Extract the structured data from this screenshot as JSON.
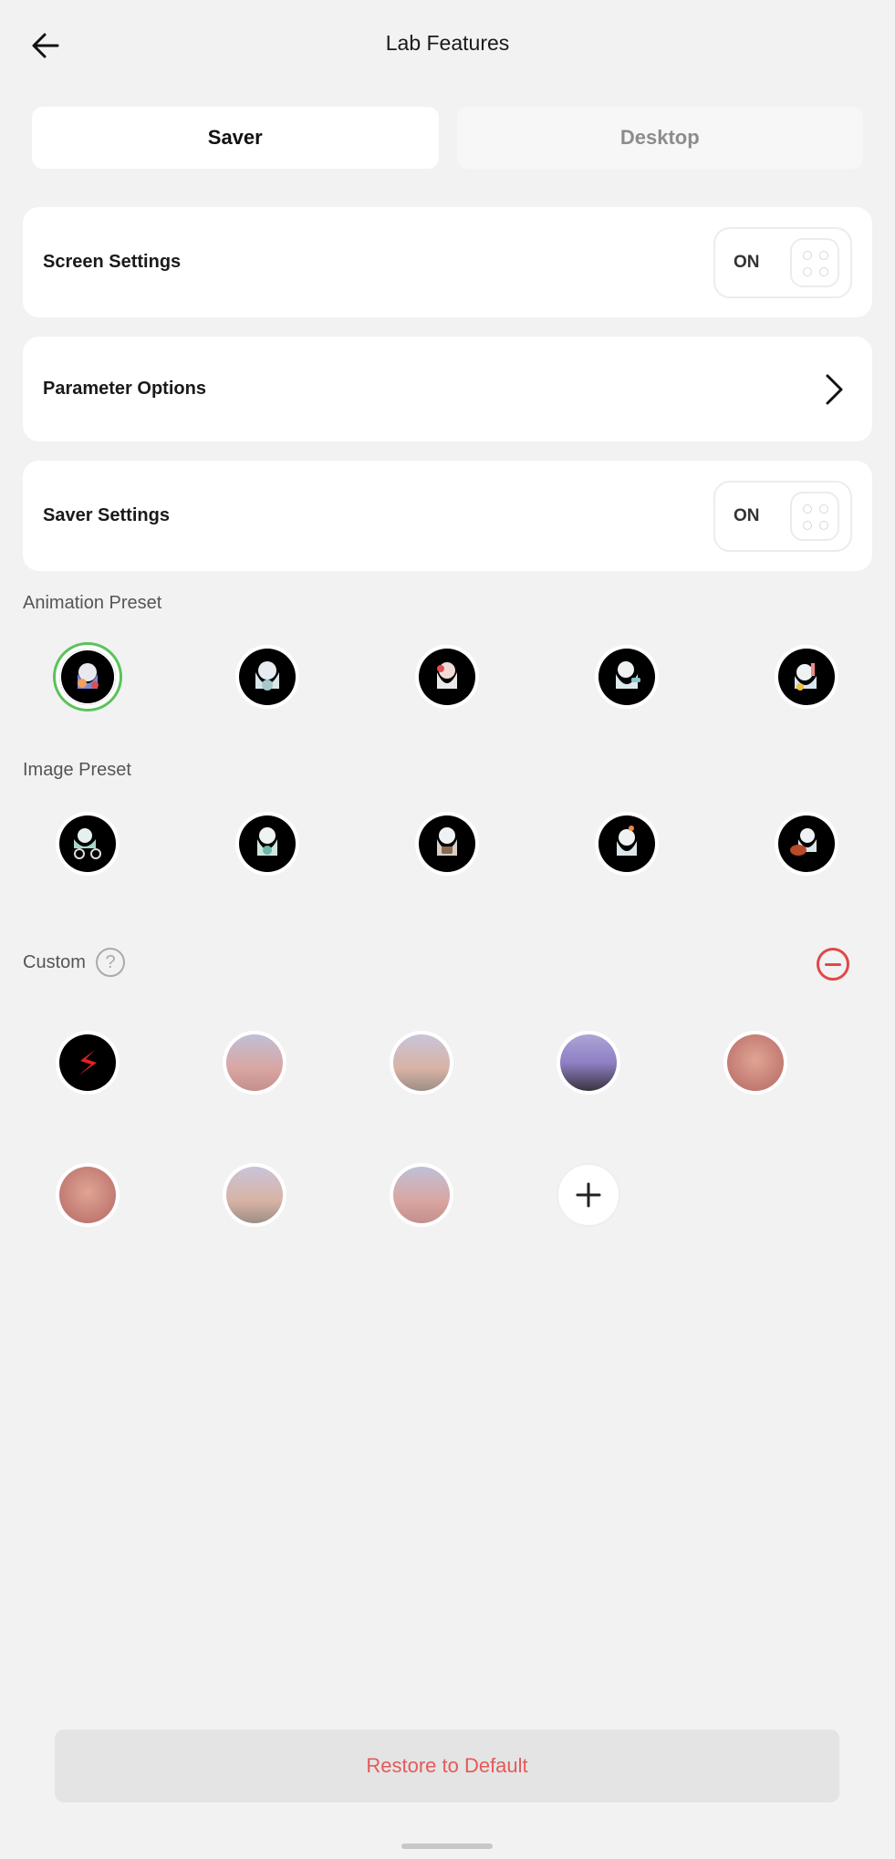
{
  "header": {
    "title": "Lab Features",
    "back_icon": "arrow-left-icon"
  },
  "tabs": [
    {
      "label": "Saver",
      "active": true
    },
    {
      "label": "Desktop",
      "active": false
    }
  ],
  "settings": {
    "screen": {
      "label": "Screen Settings",
      "state": "ON"
    },
    "parameter": {
      "label": "Parameter Options"
    },
    "saver": {
      "label": "Saver Settings",
      "state": "ON"
    }
  },
  "animation_preset": {
    "label": "Animation Preset",
    "count": 5,
    "selected_index": 0
  },
  "image_preset": {
    "label": "Image Preset",
    "count": 5
  },
  "custom": {
    "label": "Custom",
    "help_icon": "?",
    "count": 8
  },
  "restore_label": "Restore to Default",
  "colors": {
    "accent_green": "#59c35a",
    "danger_red": "#e04848",
    "restore_text": "#e45a5a"
  }
}
